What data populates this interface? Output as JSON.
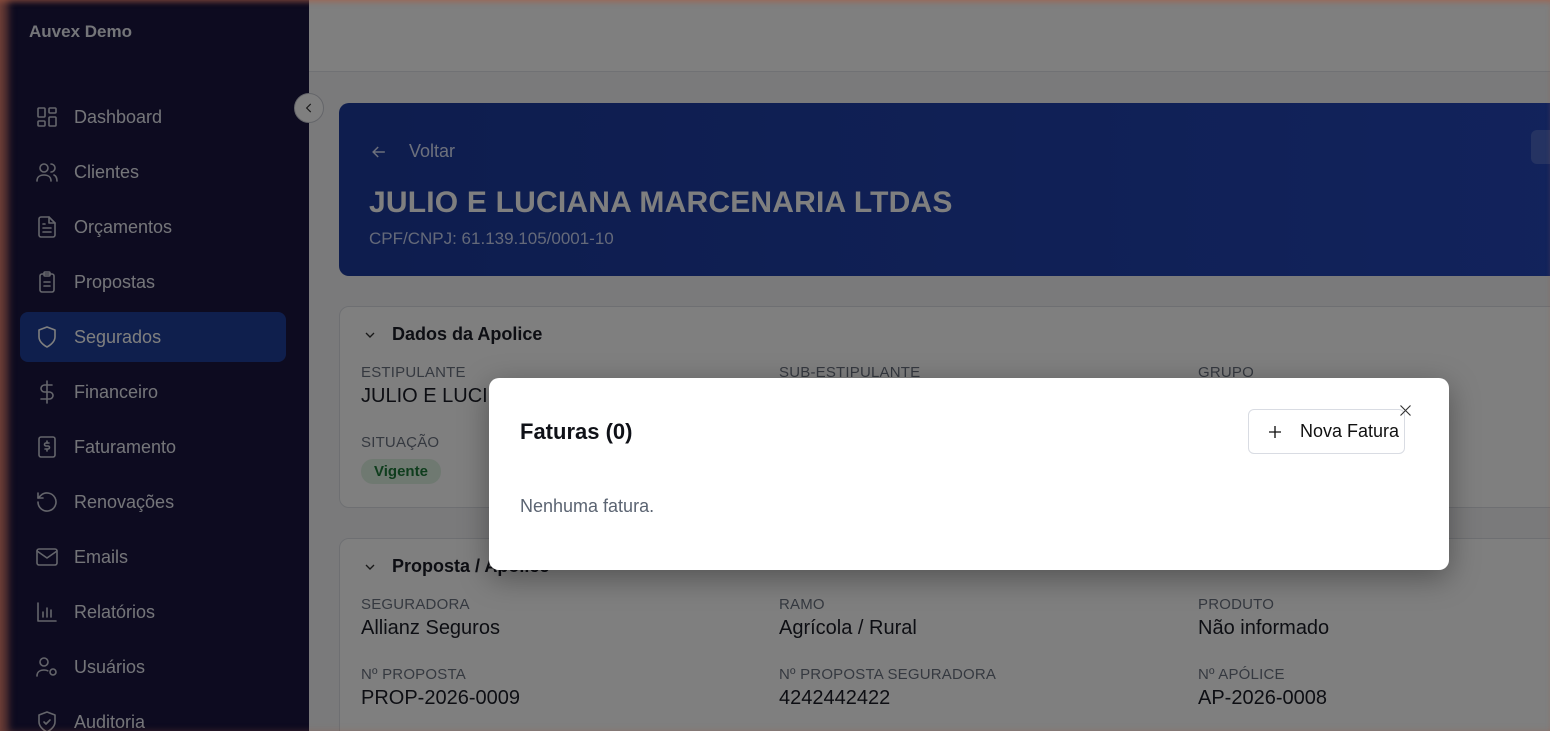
{
  "sidebar": {
    "brand": "Auvex Demo",
    "items": [
      {
        "label": "Dashboard",
        "icon": "dashboard-icon"
      },
      {
        "label": "Clientes",
        "icon": "users-icon"
      },
      {
        "label": "Orçamentos",
        "icon": "document-icon"
      },
      {
        "label": "Propostas",
        "icon": "clipboard-icon"
      },
      {
        "label": "Segurados",
        "icon": "shield-icon",
        "active": true
      },
      {
        "label": "Financeiro",
        "icon": "dollar-icon"
      },
      {
        "label": "Faturamento",
        "icon": "invoice-icon"
      },
      {
        "label": "Renovações",
        "icon": "refresh-icon"
      },
      {
        "label": "Emails",
        "icon": "mail-icon"
      },
      {
        "label": "Relatórios",
        "icon": "bar-chart-icon"
      },
      {
        "label": "Usuários",
        "icon": "user-cog-icon"
      },
      {
        "label": "Auditoria",
        "icon": "shield-check-icon"
      }
    ]
  },
  "header": {
    "back_label": "Voltar",
    "title": "JULIO E LUCIANA MARCENARIA LTDAS",
    "document": "CPF/CNPJ: 61.139.105/0001-10"
  },
  "policy_card": {
    "title": "Dados da Apolice",
    "estipulante_label": "ESTIPULANTE",
    "estipulante_value": "JULIO E LUCI",
    "sub_estipulante_label": "SUB-ESTIPULANTE",
    "grupo_label": "GRUPO",
    "situacao_label": "SITUAÇÃO",
    "situacao_value": "Vigente"
  },
  "proposal_card": {
    "title": "Proposta / Apólice",
    "seguradora_label": "SEGURADORA",
    "seguradora_value": "Allianz Seguros",
    "ramo_label": "RAMO",
    "ramo_value": "Agrícola / Rural",
    "produto_label": "PRODUTO",
    "produto_value": "Não informado",
    "proposta_label": "Nº PROPOSTA",
    "proposta_value": "PROP-2026-0009",
    "proposta_seg_label": "Nº PROPOSTA SEGURADORA",
    "proposta_seg_value": "4242442422",
    "apolice_label": "Nº APÓLICE",
    "apolice_value": "AP-2026-0008"
  },
  "modal": {
    "title": "Faturas (0)",
    "new_button": "Nova Fatura",
    "empty_text": "Nenhuma fatura."
  },
  "colors": {
    "sidebar_bg": "#1a1740",
    "accent": "#1f3f9a",
    "hero_bg": "#1c3a9c",
    "badge_green": "#1e7a3a"
  }
}
